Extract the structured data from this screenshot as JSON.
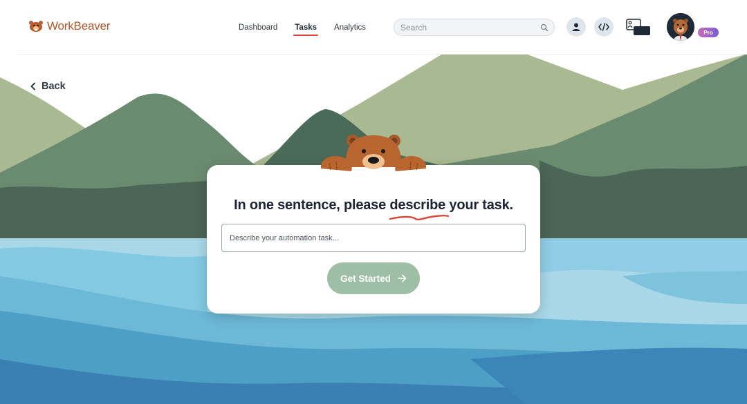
{
  "app": {
    "name": "WorkBeaver",
    "brand_color": "#b4582a",
    "accent_color": "#d9483b"
  },
  "nav": {
    "items": [
      {
        "label": "Dashboard",
        "active": false
      },
      {
        "label": "Tasks",
        "active": true
      },
      {
        "label": "Analytics",
        "active": false
      }
    ]
  },
  "search": {
    "placeholder": "Search",
    "icon": "search-icon"
  },
  "header_actions": {
    "profile_icon": "user-icon",
    "code_icon": "code-icon",
    "screen_icon": "screen-share-icon",
    "avatar": "beaver-avatar",
    "badge": "Pro"
  },
  "back": {
    "label": "Back",
    "icon": "chevron-left-icon"
  },
  "card": {
    "title": "In one sentence, please describe your task.",
    "input_placeholder": "Describe your automation task...",
    "button_label": "Get Started",
    "button_icon": "arrow-right-icon",
    "button_color": "#9ebfa5"
  }
}
